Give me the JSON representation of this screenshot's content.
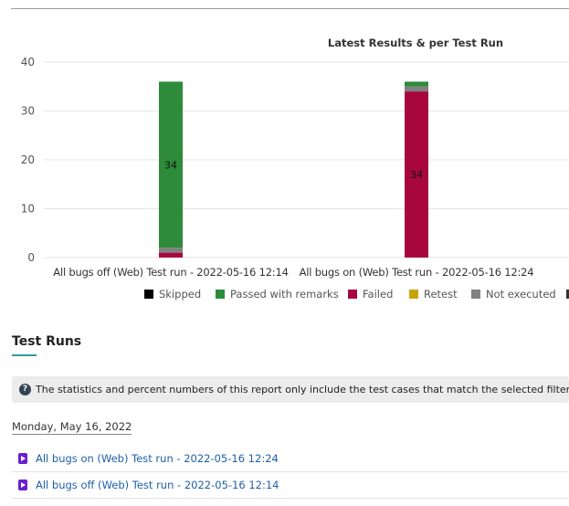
{
  "chart_data": {
    "type": "bar",
    "stacked": true,
    "title": "Latest Results & per Test Run",
    "categories": [
      "All bugs off (Web) Test run - 2022-05-16 12:14",
      "All bugs on (Web) Test run - 2022-05-16 12:24"
    ],
    "ylim": [
      0,
      40
    ],
    "yticks": [
      "0",
      "10",
      "20",
      "30",
      "40"
    ],
    "grid": true,
    "legend_position": "bottom",
    "series": [
      {
        "name": "Skipped",
        "color": "#000000",
        "values": [
          0,
          0
        ]
      },
      {
        "name": "Passed with remarks",
        "color": "#2e8b3a",
        "values": [
          34,
          1
        ]
      },
      {
        "name": "Failed",
        "color": "#a8073d",
        "values": [
          1,
          34
        ]
      },
      {
        "name": "Retest",
        "color": "#c9a30a",
        "values": [
          0,
          0
        ]
      },
      {
        "name": "Not executed",
        "color": "#808080",
        "values": [
          1,
          1
        ]
      }
    ],
    "data_labels": [
      {
        "category_index": 0,
        "series_index": 1,
        "text": "34"
      },
      {
        "category_index": 1,
        "series_index": 2,
        "text": "34"
      }
    ]
  },
  "test_runs": {
    "title": "Test Runs",
    "info_icon": "question-circle-icon",
    "info_text": "The statistics and percent numbers of this report only include the test cases that match the selected filters, if any.",
    "date": "Monday, May 16, 2022",
    "runs": [
      {
        "label": "All bugs on (Web) Test run - 2022-05-16 12:24",
        "icon": "test-run-icon"
      },
      {
        "label": "All bugs off (Web) Test run - 2022-05-16 12:14",
        "icon": "test-run-icon"
      }
    ]
  }
}
